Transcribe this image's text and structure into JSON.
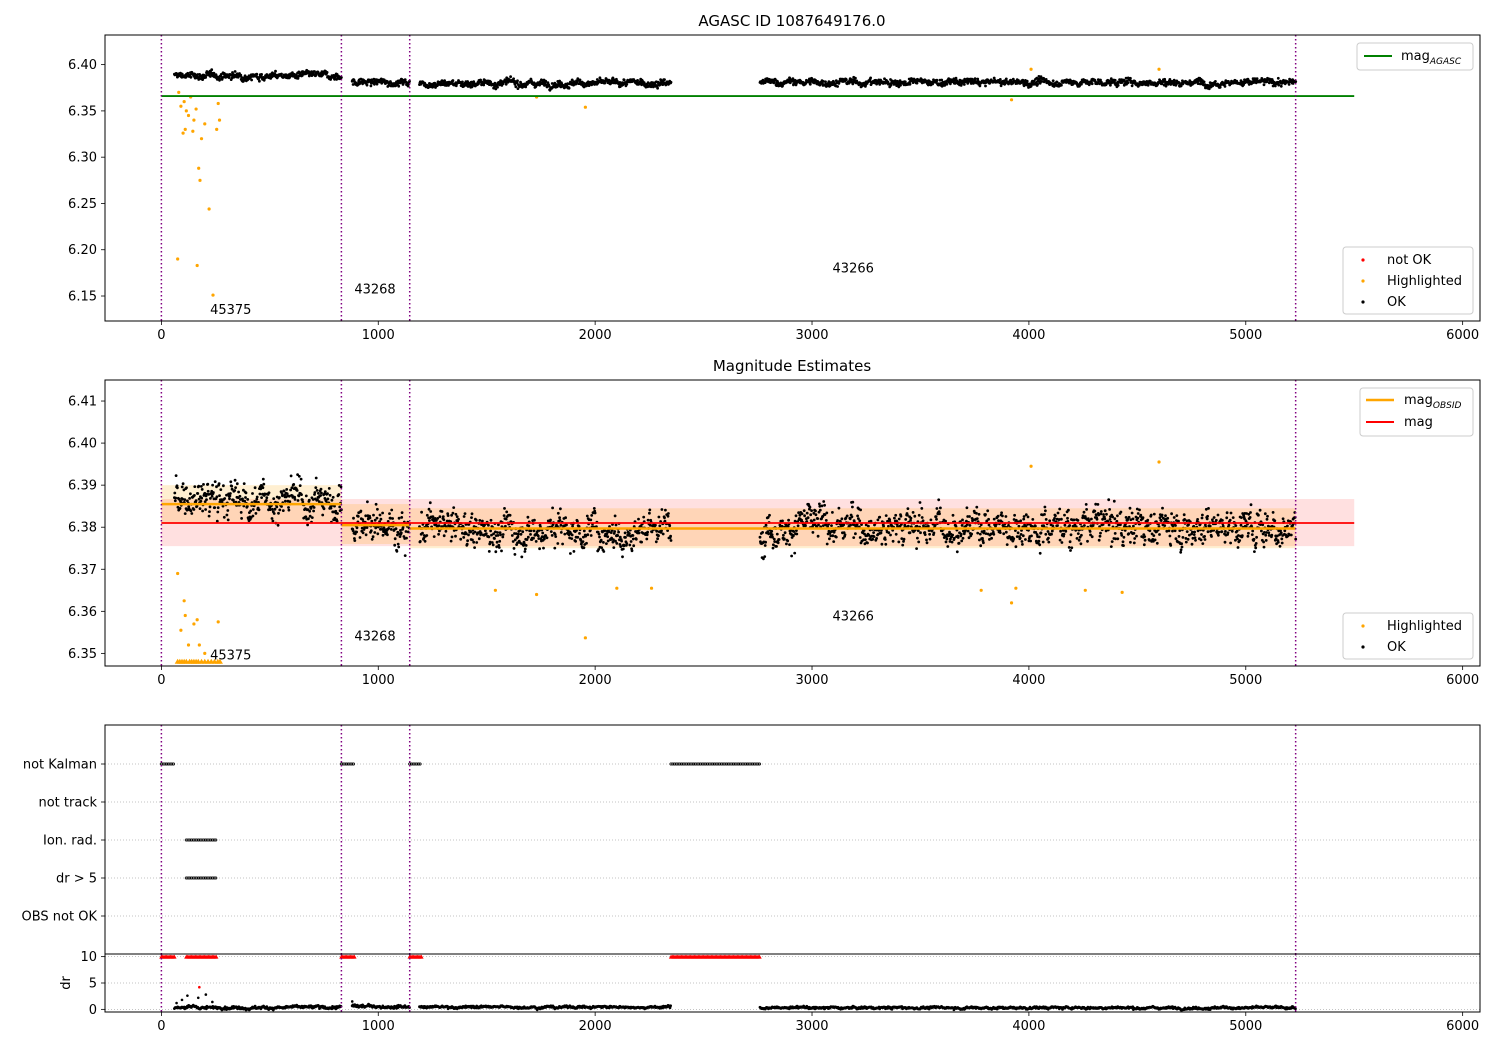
{
  "chart_data": [
    {
      "type": "scatter",
      "title": "AGASC ID 1087649176.0",
      "xlim": [
        -260,
        6080
      ],
      "ylim": [
        6.123,
        6.432
      ],
      "xticks": [
        0,
        1000,
        2000,
        3000,
        4000,
        5000,
        6000
      ],
      "yticks": [
        6.15,
        6.2,
        6.25,
        6.3,
        6.35,
        6.4
      ],
      "ytick_labels": [
        "6.15",
        "6.20",
        "6.25",
        "6.30",
        "6.35",
        "6.40"
      ],
      "grid": false,
      "reference_line": {
        "name": "mag",
        "subscript": "AGASC",
        "value": 6.366,
        "x_range": [
          0,
          5500
        ],
        "color": "#008000"
      },
      "legend_top": {
        "position": "upper right"
      },
      "legend_bottom": {
        "position": "lower right",
        "entries": [
          "not OK",
          "Highlighted",
          "OK"
        ]
      },
      "series_colors": {
        "not OK": "#ff0000",
        "Highlighted": "#ffa500",
        "OK": "#000000"
      },
      "obsid_boundaries": [
        0,
        830,
        1145,
        5230
      ],
      "obsid_labels": [
        {
          "text": "45375",
          "x": 320,
          "y": 6.136
        },
        {
          "text": "43268",
          "x": 985,
          "y": 6.158
        },
        {
          "text": "43266",
          "x": 3190,
          "y": 6.181
        }
      ],
      "ok_segments": [
        {
          "x_start": 60,
          "x_end": 830,
          "mean": 6.388,
          "spread": 0.004
        },
        {
          "x_start": 880,
          "x_end": 1145,
          "mean": 6.381,
          "spread": 0.004
        },
        {
          "x_start": 1190,
          "x_end": 2350,
          "mean": 6.38,
          "spread": 0.004
        },
        {
          "x_start": 2760,
          "x_end": 5230,
          "mean": 6.381,
          "spread": 0.004
        }
      ],
      "highlighted_points": [
        [
          75,
          6.19
        ],
        [
          80,
          6.37
        ],
        [
          90,
          6.355
        ],
        [
          100,
          6.326
        ],
        [
          105,
          6.36
        ],
        [
          110,
          6.33
        ],
        [
          115,
          6.35
        ],
        [
          125,
          6.345
        ],
        [
          135,
          6.365
        ],
        [
          145,
          6.328
        ],
        [
          150,
          6.34
        ],
        [
          160,
          6.352
        ],
        [
          165,
          6.183
        ],
        [
          172,
          6.288
        ],
        [
          178,
          6.275
        ],
        [
          185,
          6.32
        ],
        [
          200,
          6.336
        ],
        [
          220,
          6.244
        ],
        [
          238,
          6.151
        ],
        [
          255,
          6.33
        ],
        [
          262,
          6.358
        ],
        [
          268,
          6.34
        ],
        [
          1730,
          6.365
        ],
        [
          1955,
          6.354
        ],
        [
          3920,
          6.362
        ],
        [
          4010,
          6.395
        ],
        [
          4600,
          6.395
        ]
      ]
    },
    {
      "type": "scatter",
      "title": "Magnitude Estimates",
      "xlim": [
        -260,
        6080
      ],
      "ylim": [
        6.347,
        6.415
      ],
      "xticks": [
        0,
        1000,
        2000,
        3000,
        4000,
        5000,
        6000
      ],
      "yticks": [
        6.35,
        6.36,
        6.37,
        6.38,
        6.39,
        6.4,
        6.41
      ],
      "ytick_labels": [
        "6.35",
        "6.36",
        "6.37",
        "6.38",
        "6.39",
        "6.40",
        "6.41"
      ],
      "grid": false,
      "mag_line": {
        "name": "mag",
        "value": 6.381,
        "band": [
          6.3755,
          6.3867
        ],
        "x_range": [
          0,
          5500
        ],
        "color": "#ff0000"
      },
      "obsid_segments": [
        {
          "x_start": 0,
          "x_end": 830,
          "mag": 6.3855,
          "band": [
            6.381,
            6.39
          ]
        },
        {
          "x_start": 830,
          "x_end": 1145,
          "mag": 6.3805,
          "band": [
            6.376,
            6.3855
          ]
        },
        {
          "x_start": 1145,
          "x_end": 5230,
          "mag": 6.3797,
          "band": [
            6.375,
            6.3845
          ]
        }
      ],
      "obsid_line_name": "mag",
      "obsid_line_subscript": "OBSID",
      "obsid_line_color": "#ffa500",
      "legend_top": {
        "position": "upper right"
      },
      "legend_bottom": {
        "position": "lower right",
        "entries": [
          "Highlighted",
          "OK"
        ]
      },
      "obsid_boundaries": [
        0,
        830,
        1145,
        5230
      ],
      "obsid_labels": [
        {
          "text": "45375",
          "x": 320,
          "y": 6.3497
        },
        {
          "text": "43268",
          "x": 985,
          "y": 6.3543
        },
        {
          "text": "43266",
          "x": 3190,
          "y": 6.359
        }
      ],
      "ok_segments": [
        {
          "x_start": 60,
          "x_end": 830,
          "mean": 6.3865,
          "spread": 0.0045
        },
        {
          "x_start": 880,
          "x_end": 1145,
          "mean": 6.3805,
          "spread": 0.0045
        },
        {
          "x_start": 1190,
          "x_end": 2350,
          "mean": 6.3795,
          "spread": 0.0045
        },
        {
          "x_start": 2760,
          "x_end": 5230,
          "mean": 6.3805,
          "spread": 0.0045
        }
      ],
      "highlighted_points": [
        [
          75,
          6.369
        ],
        [
          90,
          6.3555
        ],
        [
          105,
          6.3625
        ],
        [
          110,
          6.359
        ],
        [
          125,
          6.352
        ],
        [
          150,
          6.357
        ],
        [
          165,
          6.358
        ],
        [
          175,
          6.352
        ],
        [
          200,
          6.35
        ],
        [
          262,
          6.3575
        ],
        [
          1540,
          6.365
        ],
        [
          1730,
          6.364
        ],
        [
          1955,
          6.3537
        ],
        [
          2100,
          6.3655
        ],
        [
          2260,
          6.3655
        ],
        [
          3780,
          6.365
        ],
        [
          3920,
          6.362
        ],
        [
          3940,
          6.3655
        ],
        [
          4010,
          6.3945
        ],
        [
          4260,
          6.365
        ],
        [
          4430,
          6.3645
        ],
        [
          4600,
          6.3955
        ]
      ],
      "clipped_highlighted_x": [
        75,
        85,
        95,
        105,
        115,
        130,
        140,
        150,
        160,
        170,
        185,
        200,
        215,
        230,
        245,
        260,
        270
      ],
      "clipped_highlighted_y": 6.348
    },
    {
      "type": "scatter",
      "title": "",
      "xlim": [
        -260,
        6080
      ],
      "categories": [
        "not Kalman",
        "not track",
        "Ion. rad.",
        "dr > 5",
        "OBS not OK"
      ],
      "grid": "y, dotted",
      "flag_ranges": {
        "not Kalman": [
          [
            0,
            60
          ],
          [
            830,
            890
          ],
          [
            1145,
            1200
          ],
          [
            2350,
            2760
          ]
        ],
        "not track": [],
        "Ion. rad.": [
          [
            115,
            255
          ]
        ],
        "dr > 5": [
          [
            115,
            255
          ]
        ],
        "OBS not OK": []
      },
      "obsid_boundaries": [
        0,
        830,
        1145,
        5230
      ]
    },
    {
      "type": "scatter",
      "title": "",
      "ylabel": "dr",
      "xlim": [
        -260,
        6080
      ],
      "ylim": [
        -0.5,
        10.5
      ],
      "xticks": [
        0,
        1000,
        2000,
        3000,
        4000,
        5000,
        6000
      ],
      "yticks": [
        0,
        5,
        10
      ],
      "ytick_labels": [
        "0",
        "5",
        "10"
      ],
      "grid": "y, dotted",
      "clipped_red_ranges": [
        [
          0,
          60
        ],
        [
          115,
          255
        ],
        [
          830,
          890
        ],
        [
          1145,
          1200
        ],
        [
          2350,
          2760
        ]
      ],
      "clipped_value": 10,
      "red_points": [
        [
          175,
          4.2
        ]
      ],
      "ok_segments": [
        {
          "x_start": 60,
          "x_end": 830,
          "mean": 0.35,
          "spread": 0.3
        },
        {
          "x_start": 880,
          "x_end": 1145,
          "mean": 0.6,
          "spread": 0.3
        },
        {
          "x_start": 1190,
          "x_end": 2350,
          "mean": 0.45,
          "spread": 0.25
        },
        {
          "x_start": 2760,
          "x_end": 5230,
          "mean": 0.3,
          "spread": 0.25
        }
      ],
      "spike_points": [
        [
          70,
          1.2
        ],
        [
          95,
          1.8
        ],
        [
          120,
          2.6
        ],
        [
          170,
          2.2
        ],
        [
          205,
          2.8
        ],
        [
          235,
          1.4
        ],
        [
          880,
          1.5
        ]
      ],
      "obsid_boundaries": [
        0,
        830,
        1145,
        5230
      ]
    }
  ]
}
